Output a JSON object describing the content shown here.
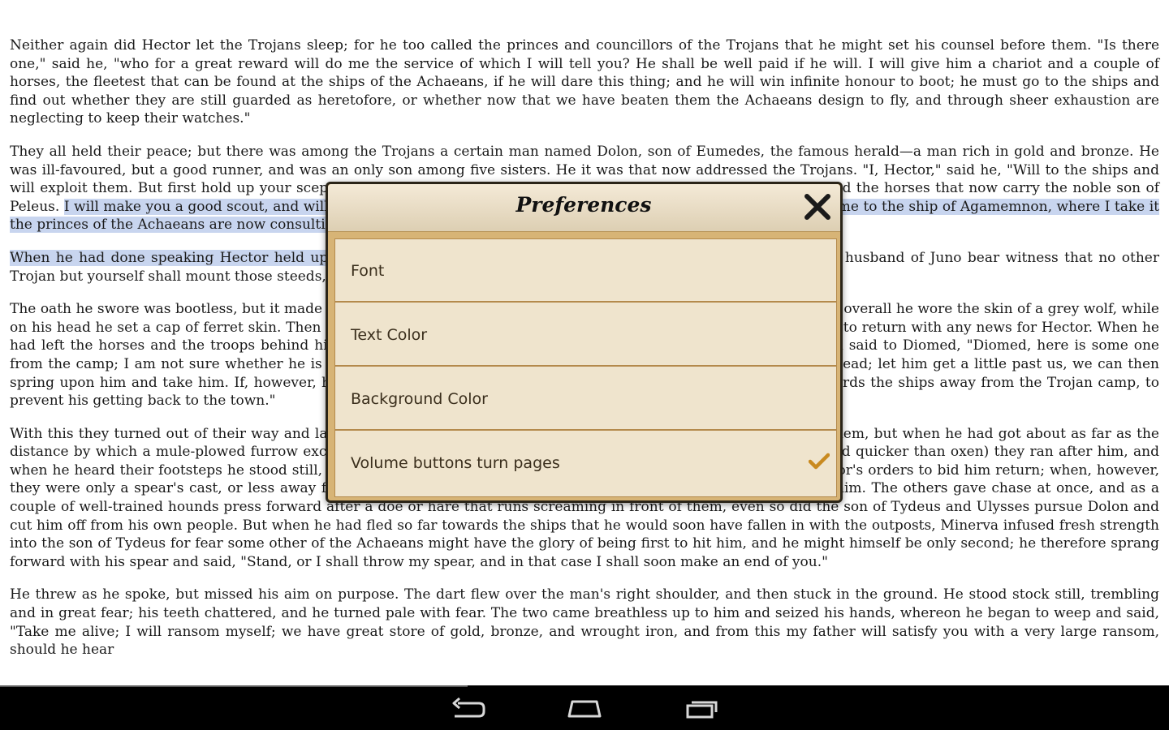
{
  "reader": {
    "paragraphs": [
      {
        "segments": [
          {
            "text": "Neither again did Hector let the Trojans sleep; for he too called the princes and councillors of the Trojans that he might set his counsel before them. \"Is there one,\" said he, \"who for a great reward will do me the service of which I will tell you? He shall be well paid if he will. I will give him a chariot and a couple of horses, the fleetest that can be found at the ships of the Achaeans, if he will dare this thing; and he will win infinite honour to boot; he must go to the ships and find out whether they are still guarded as heretofore, or whether now that we have beaten them the Achaeans design to fly, and through sheer exhaustion are neglecting to keep their watches.\"",
            "highlighted": false
          }
        ]
      },
      {
        "segments": [
          {
            "text": "They all held their peace; but there was among the Trojans a certain man named Dolon, son of Eumedes, the famous herald—a man rich in gold and bronze. He was ill-favoured, but a good runner, and was an only son among five sisters. He it was that now addressed the Trojans. \"I, Hector,\" said he, \"Will to the ships and will exploit them. But first hold up your sceptre and swear that you will give me the chariot, bedight with bronze, and the horses that now carry the noble son of Peleus. ",
            "highlighted": false
          },
          {
            "text": "I will make you a good scout, and will not fail you. I will go through the host from one end to the other till I come to the ship of Agamemnon, where I take it the princes of the Achaeans are now consulting whether they shall fight or fly.\"",
            "highlighted": true
          }
        ]
      },
      {
        "segments": [
          {
            "text": "When he had done speaking Hector held up his sceptre,",
            "highlighted": true
          },
          {
            "text": " and swore him his oath saying, \"May Jove the thundering husband of Juno bear witness that no other Trojan but yourself shall mount those steeds, and that you shall have your will with them for ever.\"",
            "highlighted": false
          }
        ]
      },
      {
        "segments": [
          {
            "text": "The oath he swore was bootless, but it made Dolon more keen on going. He hung his bow over his shoulder, and as an overall he wore the skin of a grey wolf, while on his head he set a cap of ferret skin. Then he took a pointed javelin, and left the camp for the ships, but he was not to return with any news for Hector. When he had left the horses and the troops behind him, he made all speed on his way, but Ulysses perceived his coming and said to Diomed, \"Diomed, here is some one from the camp; I am not sure whether he is a spy, or whether it is some thief who would plunder the bodies of the dead; let him get a little past us, we can then spring upon him and take him. If, however, he is too quick for us, go after him with your spear and hem him in towards the ships away from the Trojan camp, to prevent his getting back to the town.\"",
            "highlighted": false
          }
        ]
      },
      {
        "segments": [
          {
            "text": "With this they turned out of their way and lay down among the corpses. Dolon suspected nothing and soon passed them, but when he had got about as far as the distance by which a mule-plowed furrow exceeds one that has been ploughed by oxen (for mules can plow fallow land quicker than oxen) they ran after him, and when he heard their footsteps he stood still, for he made sure they were friends from the Trojan camp come by Hector's orders to bid him return; when, however, they were only a spear's cast, or less away form him, he saw that they were enemies as fast as his legs could take him. The others gave chase at once, and as a couple of well-trained hounds press forward after a doe or hare that runs screaming in front of them, even so did the son of Tydeus and Ulysses pursue Dolon and cut him off from his own people. But when he had fled so far towards the ships that he would soon have fallen in with the outposts, Minerva infused fresh strength into the son of Tydeus for fear some other of the Achaeans might have the glory of being first to hit him, and he might himself be only second; he therefore sprang forward with his spear and said, \"Stand, or I shall throw my spear, and in that case I shall soon make an end of you.\"",
            "highlighted": false
          }
        ]
      },
      {
        "segments": [
          {
            "text": "He threw as he spoke, but missed his aim on purpose. The dart flew over the man's right shoulder, and then stuck in the ground. He stood stock still, trembling and in great fear; his teeth chattered, and he turned pale with fear. The two came breathless up to him and seized his hands, whereon he began to weep and said, \"Take me alive; I will ransom myself; we have great store of gold, bronze, and wrought iron, and from this my father will satisfy you with a very large ransom, should he hear",
            "highlighted": false
          }
        ]
      }
    ]
  },
  "dialog": {
    "title": "Preferences",
    "close_icon": "close-x-icon",
    "options": [
      {
        "label": "Font",
        "checked": false
      },
      {
        "label": "Text Color",
        "checked": false
      },
      {
        "label": "Background Color",
        "checked": false
      },
      {
        "label": "Volume buttons turn pages",
        "checked": true
      }
    ]
  },
  "navbar": {
    "buttons": [
      {
        "name": "back-icon"
      },
      {
        "name": "home-icon"
      },
      {
        "name": "recent-apps-icon"
      }
    ]
  },
  "colors": {
    "highlight": "#c8d5ef",
    "dialog_frame": "#d7b476",
    "option_bg": "#efe4cd",
    "check_accent": "#c98a1f"
  }
}
